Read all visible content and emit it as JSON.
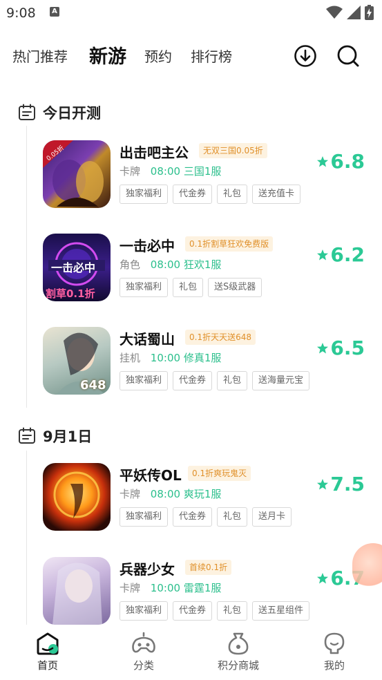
{
  "status_bar": {
    "time": "9:08",
    "notif_letter": "A"
  },
  "top_nav": {
    "tabs": [
      {
        "label": "热门推荐"
      },
      {
        "label": "新游"
      },
      {
        "label": "预约"
      },
      {
        "label": "排行榜"
      }
    ],
    "active_tab": "新游",
    "icons": [
      "download-icon",
      "search-icon"
    ]
  },
  "sections": [
    {
      "date": "今日开测",
      "games": [
        {
          "name": "出击吧主公",
          "promo": "无双三国0.05折",
          "category": "卡牌",
          "time": "08:00",
          "server": "三国1服",
          "tags": [
            "独家福利",
            "代金券",
            "礼包",
            "送充值卡"
          ],
          "rating": "6.8",
          "icon_badge": "0.05折"
        },
        {
          "name": "一击必中",
          "promo": "0.1折割草狂欢免费版",
          "category": "角色",
          "time": "08:00",
          "server": "狂欢1服",
          "tags": [
            "独家福利",
            "礼包",
            "送S级武器"
          ],
          "rating": "6.2",
          "icon_text": "割草0.1折"
        },
        {
          "name": "大话蜀山",
          "promo": "0.1折天天送648",
          "category": "挂机",
          "time": "10:00",
          "server": "修真1服",
          "tags": [
            "独家福利",
            "代金券",
            "礼包",
            "送海量元宝"
          ],
          "rating": "6.5",
          "icon_text": "648"
        }
      ]
    },
    {
      "date": "9月1日",
      "games": [
        {
          "name": "平妖传OL",
          "promo": "0.1折爽玩鬼灭",
          "category": "卡牌",
          "time": "08:00",
          "server": "爽玩1服",
          "tags": [
            "独家福利",
            "代金券",
            "礼包",
            "送月卡"
          ],
          "rating": "7.5"
        },
        {
          "name": "兵器少女",
          "promo": "首续0.1折",
          "category": "卡牌",
          "time": "10:00",
          "server": "雷霆1服",
          "tags": [
            "独家福利",
            "代金券",
            "礼包",
            "送五星组件"
          ],
          "rating": "6.7"
        }
      ]
    }
  ],
  "bottom_nav": {
    "items": [
      {
        "label": "首页",
        "icon": "home-icon"
      },
      {
        "label": "分类",
        "icon": "gamepad-icon"
      },
      {
        "label": "积分商城",
        "icon": "points-bag-icon"
      },
      {
        "label": "我的",
        "icon": "profile-icon"
      }
    ],
    "active": "首页"
  },
  "colors": {
    "accent": "#2bc995",
    "server_green": "#2bbf8c",
    "promo_orange": "#e0902a",
    "promo_bg": "#fdf2e0"
  }
}
